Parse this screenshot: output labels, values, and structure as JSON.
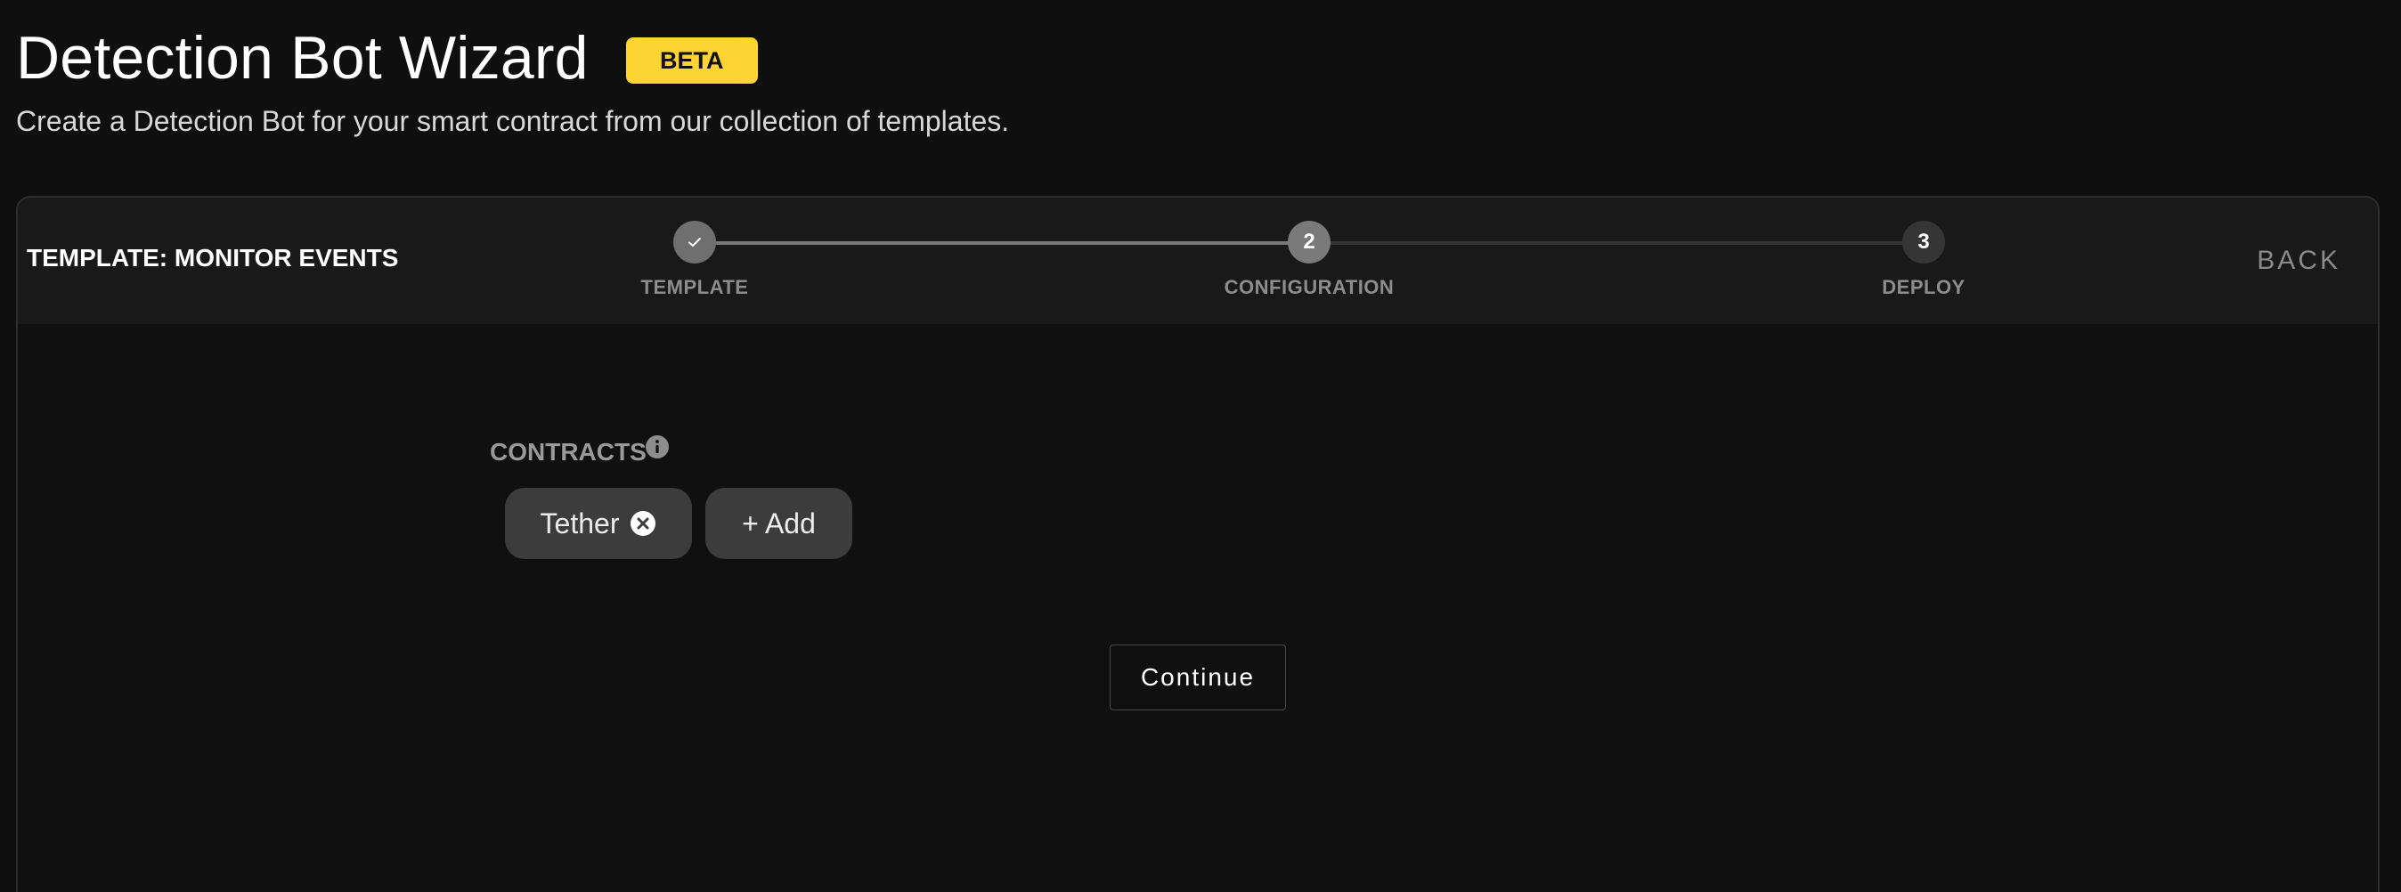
{
  "header": {
    "title": "Detection Bot Wizard",
    "badge": "BETA",
    "subtitle": "Create a Detection Bot for your smart contract from our collection of templates."
  },
  "wizard": {
    "template_name": "TEMPLATE: MONITOR EVENTS",
    "back_label": "BACK",
    "steps": [
      {
        "label": "TEMPLATE",
        "number": "",
        "state": "completed",
        "icon": "check-icon"
      },
      {
        "label": "CONFIGURATION",
        "number": "2",
        "state": "active"
      },
      {
        "label": "DEPLOY",
        "number": "3",
        "state": "upcoming"
      }
    ]
  },
  "form": {
    "contracts_label": "CONTRACTS",
    "info_icon": "info-icon",
    "chips": [
      {
        "label": "Tether",
        "remove_icon": "close-circle-icon"
      }
    ],
    "add_label": "+ Add",
    "continue_label": "Continue"
  },
  "colors": {
    "background": "#0f0f0f",
    "header_bar": "#191919",
    "badge": "#fdd431",
    "chip": "#3c3c3c",
    "muted_text": "#8d8d8d"
  }
}
